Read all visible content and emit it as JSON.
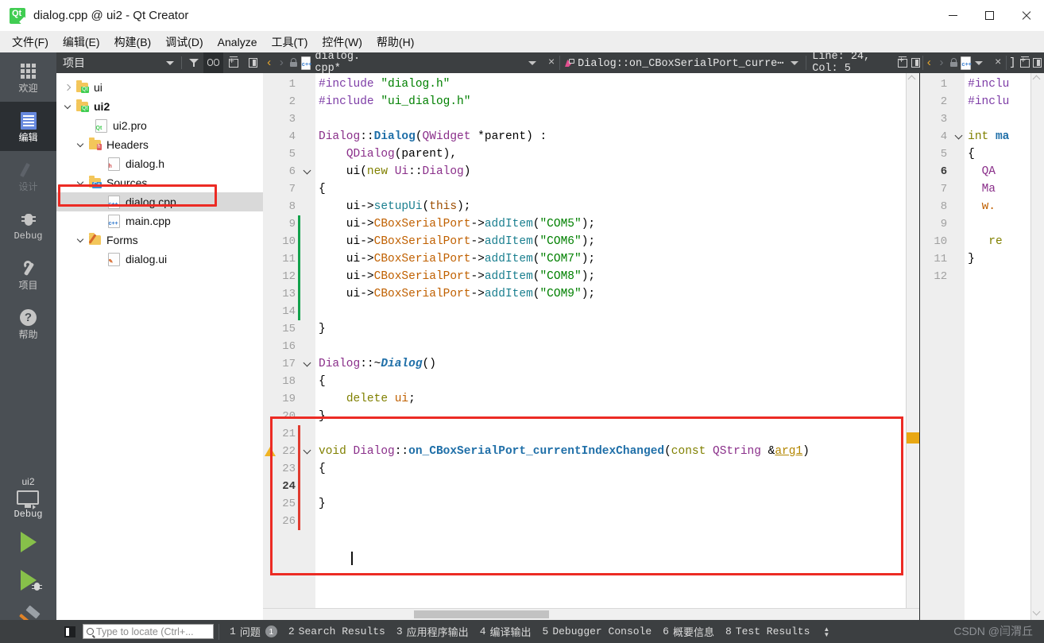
{
  "window": {
    "title": "dialog.cpp @ ui2 - Qt Creator",
    "app_icon": "qt-logo-icon",
    "minimize": "−",
    "maximize": "□",
    "close": "×"
  },
  "menubar": {
    "items": [
      {
        "label": "文件(F)",
        "name": "menu-file"
      },
      {
        "label": "编辑(E)",
        "name": "menu-edit"
      },
      {
        "label": "构建(B)",
        "name": "menu-build"
      },
      {
        "label": "调试(D)",
        "name": "menu-debug"
      },
      {
        "label": "Analyze",
        "name": "menu-analyze"
      },
      {
        "label": "工具(T)",
        "name": "menu-tools"
      },
      {
        "label": "控件(W)",
        "name": "menu-window"
      },
      {
        "label": "帮助(H)",
        "name": "menu-help"
      }
    ]
  },
  "modebar": {
    "items": [
      {
        "label": "欢迎",
        "icon": "grid-icon",
        "state": "normal"
      },
      {
        "label": "编辑",
        "icon": "document-lines-icon",
        "state": "active"
      },
      {
        "label": "设计",
        "icon": "pencil-icon",
        "state": "disabled"
      },
      {
        "label": "Debug",
        "icon": "bug-icon",
        "state": "normal"
      },
      {
        "label": "项目",
        "icon": "wrench-icon",
        "state": "normal"
      },
      {
        "label": "帮助",
        "icon": "question-mark-icon",
        "state": "normal"
      }
    ],
    "kit_name": "ui2",
    "kit_mode": "Debug",
    "run_button": "run-icon",
    "debug_button": "start-debugging-icon",
    "build_button": "build-hammer-icon"
  },
  "project_panel": {
    "title": "项目",
    "toolbar": [
      {
        "name": "filter-dropdown-caret",
        "icon": "chevron-down-icon"
      },
      {
        "name": "filter-tree-button",
        "icon": "filter-icon"
      },
      {
        "name": "synchronize-with-editor-button",
        "icon": "link-icon"
      },
      {
        "name": "split-button",
        "icon": "split-plus-icon"
      },
      {
        "name": "close-sidebar-button",
        "icon": "panel-icon"
      }
    ],
    "tree": [
      {
        "label": "ui",
        "indent": 0,
        "twist": "right",
        "icon": "qt-project-folder",
        "bold": false,
        "selected": false
      },
      {
        "label": "ui2",
        "indent": 0,
        "twist": "down",
        "icon": "qt-project-folder",
        "bold": true,
        "selected": false
      },
      {
        "label": "ui2.pro",
        "indent": 1,
        "twist": "none",
        "icon": "pro-file",
        "bold": false,
        "selected": false
      },
      {
        "label": "Headers",
        "indent": 1,
        "twist": "down",
        "icon": "headers-folder",
        "bold": false,
        "selected": false
      },
      {
        "label": "dialog.h",
        "indent": 2,
        "twist": "none",
        "icon": "h-file",
        "bold": false,
        "selected": false
      },
      {
        "label": "Sources",
        "indent": 1,
        "twist": "down",
        "icon": "sources-folder",
        "bold": false,
        "selected": false
      },
      {
        "label": "dialog.cpp",
        "indent": 2,
        "twist": "none",
        "icon": "cpp-file",
        "bold": false,
        "selected": true
      },
      {
        "label": "main.cpp",
        "indent": 2,
        "twist": "none",
        "icon": "cpp-file",
        "bold": false,
        "selected": false
      },
      {
        "label": "Forms",
        "indent": 1,
        "twist": "down",
        "icon": "forms-folder",
        "bold": false,
        "selected": false
      },
      {
        "label": "dialog.ui",
        "indent": 2,
        "twist": "none",
        "icon": "ui-file",
        "bold": false,
        "selected": false
      }
    ]
  },
  "editor_toolbar": {
    "back": "‹",
    "forward": "›",
    "lock": "unlocked-icon",
    "file_icon": "cpp-file-icon",
    "filename": "dialog. cpp*",
    "dropdown": "chevron-down-icon",
    "close": "×",
    "symbol_icon": "function-symbol-icon",
    "symbol": "Dialog::on_CBoxSerialPort_curre⋯",
    "symbol_dropdown": "chevron-down-icon",
    "line_col": "Line: 24, Col: 5",
    "split_button": "split-plus-icon",
    "close_split_button": "panel-icon"
  },
  "editor_toolbar_right": {
    "back": "‹",
    "forward": "›",
    "lock": "unlocked-icon",
    "file_icon": "cpp-file-icon",
    "dropdown": "chevron-down-icon",
    "close": "×",
    "bracket": "]",
    "split_button": "split-plus-icon",
    "close_split_button": "panel-icon"
  },
  "code_left": {
    "current_line": 24,
    "lines": [
      {
        "n": 1,
        "fold": false,
        "change": "none",
        "tokens": [
          {
            "t": "#include ",
            "c": "pp"
          },
          {
            "t": "\"dialog.h\"",
            "c": "str"
          }
        ]
      },
      {
        "n": 2,
        "fold": false,
        "change": "none",
        "tokens": [
          {
            "t": "#include ",
            "c": "pp"
          },
          {
            "t": "\"ui_dialog.h\"",
            "c": "str"
          }
        ]
      },
      {
        "n": 3,
        "fold": false,
        "change": "none",
        "tokens": []
      },
      {
        "n": 4,
        "fold": false,
        "change": "none",
        "tokens": [
          {
            "t": "Dialog",
            "c": "cls"
          },
          {
            "t": "::",
            "c": "op"
          },
          {
            "t": "Dialog",
            "c": "fn"
          },
          {
            "t": "(",
            "c": "op"
          },
          {
            "t": "QWidget",
            "c": "cls"
          },
          {
            "t": " *parent) :",
            "c": "op"
          }
        ]
      },
      {
        "n": 5,
        "fold": false,
        "change": "none",
        "tokens": [
          {
            "t": "    ",
            "c": "op"
          },
          {
            "t": "QDialog",
            "c": "cls"
          },
          {
            "t": "(parent),",
            "c": "op"
          }
        ]
      },
      {
        "n": 6,
        "fold": true,
        "change": "none",
        "tokens": [
          {
            "t": "    ui(",
            "c": "op"
          },
          {
            "t": "new",
            "c": "kw"
          },
          {
            "t": " ",
            "c": "op"
          },
          {
            "t": "Ui",
            "c": "cls"
          },
          {
            "t": "::",
            "c": "op"
          },
          {
            "t": "Dialog",
            "c": "cls"
          },
          {
            "t": ")",
            "c": "op"
          }
        ]
      },
      {
        "n": 7,
        "fold": false,
        "change": "none",
        "tokens": [
          {
            "t": "{",
            "c": "op"
          }
        ]
      },
      {
        "n": 8,
        "fold": false,
        "change": "none",
        "tokens": [
          {
            "t": "    ui->",
            "c": "op"
          },
          {
            "t": "setupUi",
            "c": "var"
          },
          {
            "t": "(",
            "c": "op"
          },
          {
            "t": "this",
            "c": "decl"
          },
          {
            "t": ");",
            "c": "op"
          }
        ]
      },
      {
        "n": 9,
        "fold": false,
        "change": "green",
        "tokens": [
          {
            "t": "    ui->",
            "c": "op"
          },
          {
            "t": "CBoxSerialPort",
            "c": "fnv"
          },
          {
            "t": "->",
            "c": "op"
          },
          {
            "t": "addItem",
            "c": "var"
          },
          {
            "t": "(",
            "c": "op"
          },
          {
            "t": "\"COM5\"",
            "c": "str"
          },
          {
            "t": ");",
            "c": "op"
          }
        ]
      },
      {
        "n": 10,
        "fold": false,
        "change": "green",
        "tokens": [
          {
            "t": "    ui->",
            "c": "op"
          },
          {
            "t": "CBoxSerialPort",
            "c": "fnv"
          },
          {
            "t": "->",
            "c": "op"
          },
          {
            "t": "addItem",
            "c": "var"
          },
          {
            "t": "(",
            "c": "op"
          },
          {
            "t": "\"COM6\"",
            "c": "str"
          },
          {
            "t": ");",
            "c": "op"
          }
        ]
      },
      {
        "n": 11,
        "fold": false,
        "change": "green",
        "tokens": [
          {
            "t": "    ui->",
            "c": "op"
          },
          {
            "t": "CBoxSerialPort",
            "c": "fnv"
          },
          {
            "t": "->",
            "c": "op"
          },
          {
            "t": "addItem",
            "c": "var"
          },
          {
            "t": "(",
            "c": "op"
          },
          {
            "t": "\"COM7\"",
            "c": "str"
          },
          {
            "t": ");",
            "c": "op"
          }
        ]
      },
      {
        "n": 12,
        "fold": false,
        "change": "green",
        "tokens": [
          {
            "t": "    ui->",
            "c": "op"
          },
          {
            "t": "CBoxSerialPort",
            "c": "fnv"
          },
          {
            "t": "->",
            "c": "op"
          },
          {
            "t": "addItem",
            "c": "var"
          },
          {
            "t": "(",
            "c": "op"
          },
          {
            "t": "\"COM8\"",
            "c": "str"
          },
          {
            "t": ");",
            "c": "op"
          }
        ]
      },
      {
        "n": 13,
        "fold": false,
        "change": "green",
        "tokens": [
          {
            "t": "    ui->",
            "c": "op"
          },
          {
            "t": "CBoxSerialPort",
            "c": "fnv"
          },
          {
            "t": "->",
            "c": "op"
          },
          {
            "t": "addItem",
            "c": "var"
          },
          {
            "t": "(",
            "c": "op"
          },
          {
            "t": "\"COM9\"",
            "c": "str"
          },
          {
            "t": ");",
            "c": "op"
          }
        ]
      },
      {
        "n": 14,
        "fold": false,
        "change": "green",
        "tokens": []
      },
      {
        "n": 15,
        "fold": false,
        "change": "none",
        "tokens": [
          {
            "t": "}",
            "c": "op"
          }
        ]
      },
      {
        "n": 16,
        "fold": false,
        "change": "none",
        "tokens": []
      },
      {
        "n": 17,
        "fold": true,
        "change": "none",
        "tokens": [
          {
            "t": "Dialog",
            "c": "cls"
          },
          {
            "t": "::~",
            "c": "op"
          },
          {
            "t": "Dialog",
            "c": "ital"
          },
          {
            "t": "()",
            "c": "op"
          }
        ]
      },
      {
        "n": 18,
        "fold": false,
        "change": "none",
        "tokens": [
          {
            "t": "{",
            "c": "op"
          }
        ]
      },
      {
        "n": 19,
        "fold": false,
        "change": "none",
        "tokens": [
          {
            "t": "    ",
            "c": "op"
          },
          {
            "t": "delete",
            "c": "kw"
          },
          {
            "t": " ",
            "c": "op"
          },
          {
            "t": "ui",
            "c": "fnv"
          },
          {
            "t": ";",
            "c": "op"
          }
        ]
      },
      {
        "n": 20,
        "fold": false,
        "change": "none",
        "tokens": [
          {
            "t": "}",
            "c": "op"
          }
        ]
      },
      {
        "n": 21,
        "fold": false,
        "change": "red",
        "tokens": []
      },
      {
        "n": 22,
        "fold": true,
        "change": "red",
        "warn": true,
        "tokens": [
          {
            "t": "void",
            "c": "kw"
          },
          {
            "t": " ",
            "c": "op"
          },
          {
            "t": "Dialog",
            "c": "cls"
          },
          {
            "t": "::",
            "c": "op"
          },
          {
            "t": "on_CBoxSerialPort_currentIndexChanged",
            "c": "fn"
          },
          {
            "t": "(",
            "c": "op"
          },
          {
            "t": "const",
            "c": "kw"
          },
          {
            "t": " ",
            "c": "op"
          },
          {
            "t": "QString",
            "c": "cls"
          },
          {
            "t": " &",
            "c": "op"
          },
          {
            "t": "arg1",
            "c": "arg"
          },
          {
            "t": ")",
            "c": "op"
          }
        ]
      },
      {
        "n": 23,
        "fold": false,
        "change": "red",
        "tokens": [
          {
            "t": "{",
            "c": "op"
          }
        ]
      },
      {
        "n": 24,
        "fold": false,
        "change": "red",
        "tokens": []
      },
      {
        "n": 25,
        "fold": false,
        "change": "red",
        "tokens": [
          {
            "t": "}",
            "c": "op"
          }
        ]
      },
      {
        "n": 26,
        "fold": false,
        "change": "red",
        "tokens": []
      }
    ]
  },
  "code_right": {
    "current_line": 6,
    "lines": [
      {
        "n": 1,
        "fold": false,
        "tokens": [
          {
            "t": "#inclu",
            "c": "pp"
          }
        ]
      },
      {
        "n": 2,
        "fold": false,
        "tokens": [
          {
            "t": "#inclu",
            "c": "pp"
          }
        ]
      },
      {
        "n": 3,
        "fold": false,
        "tokens": []
      },
      {
        "n": 4,
        "fold": true,
        "tokens": [
          {
            "t": "int",
            "c": "kw"
          },
          {
            "t": " ",
            "c": "op"
          },
          {
            "t": "ma",
            "c": "fn"
          }
        ]
      },
      {
        "n": 5,
        "fold": false,
        "tokens": [
          {
            "t": "{",
            "c": "op"
          }
        ]
      },
      {
        "n": 6,
        "fold": false,
        "tokens": [
          {
            "t": "  ",
            "c": "op"
          },
          {
            "t": "QA",
            "c": "cls"
          }
        ]
      },
      {
        "n": 7,
        "fold": false,
        "tokens": [
          {
            "t": "  ",
            "c": "op"
          },
          {
            "t": "Ma",
            "c": "cls"
          }
        ]
      },
      {
        "n": 8,
        "fold": false,
        "tokens": [
          {
            "t": "  ",
            "c": "op"
          },
          {
            "t": "w.",
            "c": "fnv"
          }
        ]
      },
      {
        "n": 9,
        "fold": false,
        "tokens": []
      },
      {
        "n": 10,
        "fold": false,
        "tokens": [
          {
            "t": "   ",
            "c": "op"
          },
          {
            "t": "re",
            "c": "kw"
          }
        ]
      },
      {
        "n": 11,
        "fold": false,
        "tokens": [
          {
            "t": "}",
            "c": "op"
          }
        ]
      },
      {
        "n": 12,
        "fold": false,
        "tokens": []
      }
    ]
  },
  "statusbar": {
    "toggle_sidebar": "toggle-sidebar-icon",
    "locate_placeholder": "Type to locate (Ctrl+...",
    "search_icon": "search-icon",
    "panes": [
      {
        "num": "1",
        "label": "问题",
        "badge": "1"
      },
      {
        "num": "2",
        "label": "Search Results",
        "badge": ""
      },
      {
        "num": "3",
        "label": "应用程序输出",
        "badge": ""
      },
      {
        "num": "4",
        "label": "编译输出",
        "badge": ""
      },
      {
        "num": "5",
        "label": "Debugger Console",
        "badge": ""
      },
      {
        "num": "6",
        "label": "概要信息",
        "badge": ""
      },
      {
        "num": "8",
        "label": "Test Results",
        "badge": ""
      }
    ],
    "watermark": "CSDN @闫渭丘"
  },
  "annotations": {
    "tree_highlight": "dialog.cpp tree item outlined in red",
    "code_highlight": "new slot function block outlined in red"
  },
  "colors": {
    "accent_red": "#ec2b24",
    "mode_active": "#2b2f33",
    "chrome_dark": "#3c3f41",
    "change_green": "#12a14b",
    "change_red": "#e03b2f",
    "marker_yellow": "#e8a713"
  }
}
